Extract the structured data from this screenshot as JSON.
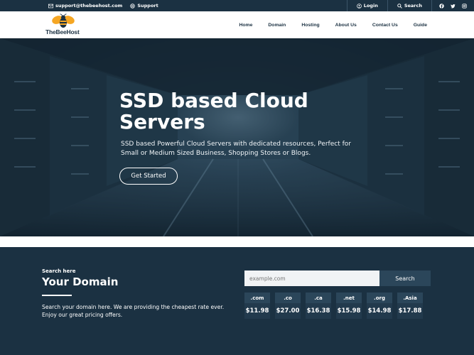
{
  "topbar": {
    "email": "support@thebeehost.com",
    "support": "Support",
    "login": "Login",
    "search": "Search",
    "social": [
      "facebook-icon",
      "twitter-icon",
      "instagram-icon"
    ]
  },
  "brand": {
    "name": "TheBeeHost"
  },
  "nav": [
    "Home",
    "Domain",
    "Hosting",
    "About Us",
    "Contact Us",
    "Guide"
  ],
  "hero": {
    "title": "SSD based Cloud Servers",
    "description": "SSD based Powerful Cloud Servers with dedicated resources, Perfect for Small or Medium Sized Business, Shopping Stores or Blogs.",
    "cta": "Get Started"
  },
  "domain": {
    "kicker": "Search here",
    "title": "Your Domain",
    "description": "Search your domain here. We are providing the cheapest rate ever. Enjoy our great pricing offers.",
    "placeholder": "example.com",
    "search_label": "Search",
    "tlds": [
      {
        "ext": ".com",
        "price": "$11.98"
      },
      {
        "ext": ".co",
        "price": "$27.00"
      },
      {
        "ext": ".ca",
        "price": "$16.38"
      },
      {
        "ext": ".net",
        "price": "$15.98"
      },
      {
        "ext": ".org",
        "price": "$14.98"
      },
      {
        "ext": ".Asia",
        "price": "$17.88"
      }
    ]
  },
  "colors": {
    "navy": "#1b3142",
    "accent": "#f5a623",
    "tile": "#2b465a"
  }
}
